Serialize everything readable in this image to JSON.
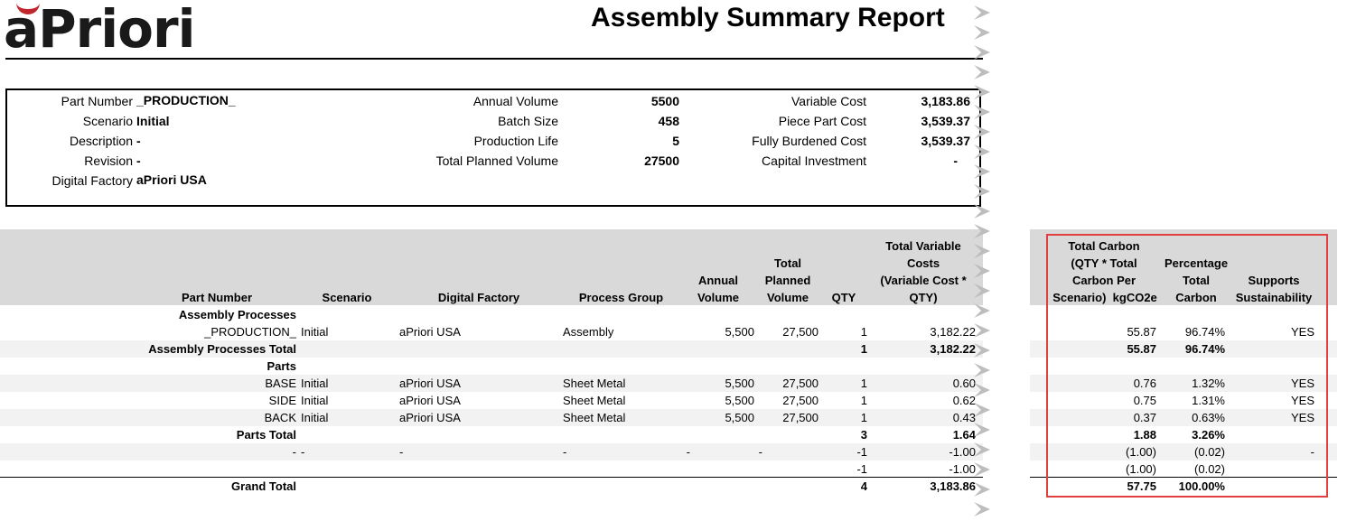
{
  "brand": {
    "logo_text": "aPriori"
  },
  "report": {
    "title": "Assembly Summary Report"
  },
  "info": {
    "col1": [
      {
        "label": "Part Number",
        "value": "_PRODUCTION_"
      },
      {
        "label": "Scenario",
        "value": "Initial"
      },
      {
        "label": "Description",
        "value": "-"
      },
      {
        "label": "Revision",
        "value": "-"
      },
      {
        "label": "Digital Factory",
        "value": "aPriori USA"
      }
    ],
    "col2": [
      {
        "label": "Annual Volume",
        "value": "5500"
      },
      {
        "label": "Batch Size",
        "value": "458"
      },
      {
        "label": "Production Life",
        "value": "5"
      },
      {
        "label": "Total Planned Volume",
        "value": "27500"
      }
    ],
    "col3": [
      {
        "label": "Variable Cost",
        "value": "3,183.86"
      },
      {
        "label": "Piece Part Cost",
        "value": "3,539.37"
      },
      {
        "label": "Fully Burdened Cost",
        "value": "3,539.37"
      },
      {
        "label": "Capital Investment",
        "value": "-"
      }
    ]
  },
  "table": {
    "headers": {
      "part_number": "Part Number",
      "scenario": "Scenario",
      "digital_factory": "Digital Factory",
      "process_group": "Process Group",
      "annual_volume": [
        "Annual",
        "Volume"
      ],
      "total_planned_volume": [
        "Total",
        "Planned",
        "Volume"
      ],
      "qty": "QTY",
      "total_variable_costs": [
        "Total Variable",
        "Costs",
        "(Variable Cost *",
        "QTY)"
      ],
      "total_carbon": [
        "Total Carbon",
        "(QTY * Total",
        "Carbon Per",
        "Scenario)  kgCO2e"
      ],
      "percentage_total_carbon": [
        "Percentage",
        "Total",
        "Carbon"
      ],
      "supports_sustainability": [
        "Supports",
        "Sustainability"
      ]
    },
    "rows": [
      {
        "type": "section",
        "part": "Assembly Processes"
      },
      {
        "type": "data",
        "part": "_PRODUCTION_",
        "scenario": "Initial",
        "factory": "aPriori USA",
        "process": "Assembly",
        "annual": "5,500",
        "planned": "27,500",
        "qty": "1",
        "cost": "3,182.22",
        "carbon": "55.87",
        "pct": "96.74%",
        "supports": "YES"
      },
      {
        "type": "total",
        "part": "Assembly Processes Total",
        "qty": "1",
        "cost": "3,182.22",
        "carbon": "55.87",
        "pct": "96.74%"
      },
      {
        "type": "section",
        "part": "Parts"
      },
      {
        "type": "data",
        "part": "BASE",
        "scenario": "Initial",
        "factory": "aPriori USA",
        "process": "Sheet Metal",
        "annual": "5,500",
        "planned": "27,500",
        "qty": "1",
        "cost": "0.60",
        "carbon": "0.76",
        "pct": "1.32%",
        "supports": "YES"
      },
      {
        "type": "data",
        "part": "SIDE",
        "scenario": "Initial",
        "factory": "aPriori USA",
        "process": "Sheet Metal",
        "annual": "5,500",
        "planned": "27,500",
        "qty": "1",
        "cost": "0.62",
        "carbon": "0.75",
        "pct": "1.31%",
        "supports": "YES"
      },
      {
        "type": "data",
        "part": "BACK",
        "scenario": "Initial",
        "factory": "aPriori USA",
        "process": "Sheet Metal",
        "annual": "5,500",
        "planned": "27,500",
        "qty": "1",
        "cost": "0.43",
        "carbon": "0.37",
        "pct": "0.63%",
        "supports": "YES"
      },
      {
        "type": "total",
        "part": "Parts Total",
        "qty": "3",
        "cost": "1.64",
        "carbon": "1.88",
        "pct": "3.26%"
      },
      {
        "type": "data",
        "part": "-",
        "scenario": "-",
        "factory": "-",
        "process": "-",
        "annual": "-",
        "planned": "-",
        "qty": "-1",
        "cost": "-1.00",
        "carbon": "(1.00)",
        "pct": "(0.02)",
        "supports": "-"
      },
      {
        "type": "data",
        "part": "",
        "scenario": "",
        "factory": "",
        "process": "",
        "annual": "",
        "planned": "",
        "qty": "-1",
        "cost": "-1.00",
        "carbon": "(1.00)",
        "pct": "(0.02)",
        "supports": ""
      },
      {
        "type": "grand",
        "part": "Grand Total",
        "qty": "4",
        "cost": "3,183.86",
        "carbon": "57.75",
        "pct": "100.00%"
      }
    ]
  }
}
